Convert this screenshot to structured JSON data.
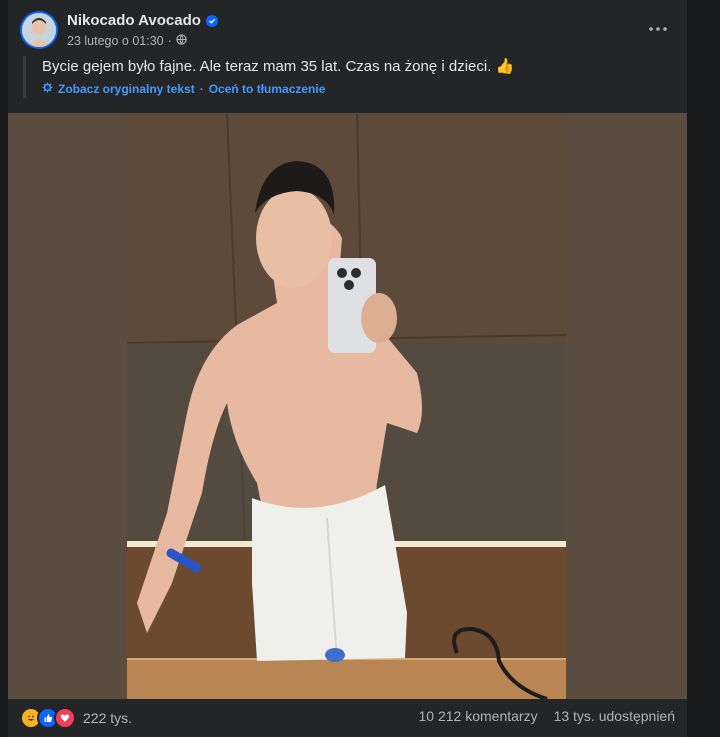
{
  "post": {
    "author": "Nikocado Avocado",
    "timestamp": "23 lutego o 01:30",
    "visibility_icon": "globe-icon",
    "more_icon": "more-options-icon",
    "text": "Bycie gejem było fajne. Ale teraz mam 35 lat. Czas na żonę i dzieci. 👍",
    "see_original": "Zobacz oryginalny tekst",
    "separator": "·",
    "rate_translation": "Oceń to tłumaczenie"
  },
  "engagement": {
    "reaction_icons": [
      "haha-icon",
      "like-icon",
      "love-icon"
    ],
    "reaction_count": "222 tys.",
    "comments": "10 212 komentarzy",
    "shares": "13 tys. udostępnień"
  },
  "colors": {
    "background": "#18191a",
    "card": "#242526",
    "link": "#4599ff",
    "verified": "#0866ff"
  }
}
